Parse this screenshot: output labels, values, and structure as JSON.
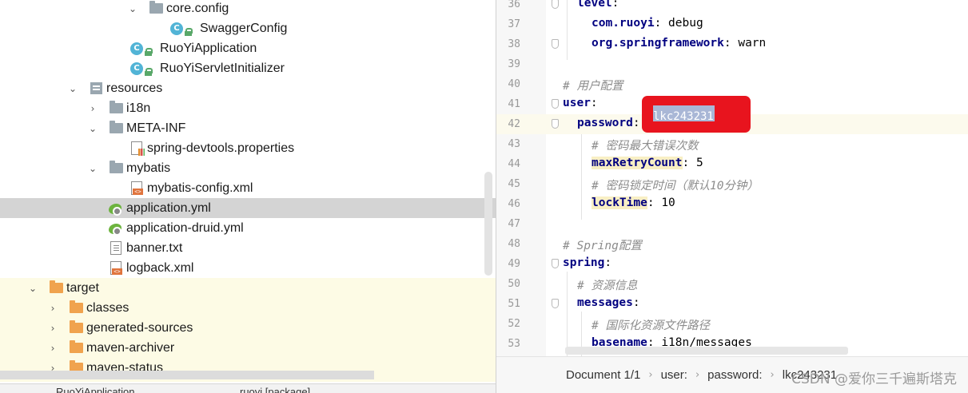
{
  "tree": {
    "items": [
      {
        "label": "core.config",
        "arrow": "⌄",
        "icon": "folder-gray"
      },
      {
        "label": "SwaggerConfig",
        "arrow": "",
        "icon": "class-c"
      },
      {
        "label": "RuoYiApplication",
        "arrow": "",
        "icon": "class-c"
      },
      {
        "label": "RuoYiServletInitializer",
        "arrow": "",
        "icon": "class-c"
      },
      {
        "label": "resources",
        "arrow": "⌄",
        "icon": "folder-res"
      },
      {
        "label": "i18n",
        "arrow": "›",
        "icon": "folder-gray"
      },
      {
        "label": "META-INF",
        "arrow": "⌄",
        "icon": "folder-gray"
      },
      {
        "label": "spring-devtools.properties",
        "arrow": "",
        "icon": "file-props"
      },
      {
        "label": "mybatis",
        "arrow": "⌄",
        "icon": "folder-gray"
      },
      {
        "label": "mybatis-config.xml",
        "arrow": "",
        "icon": "file-xml"
      },
      {
        "label": "application.yml",
        "arrow": "",
        "icon": "file-yml"
      },
      {
        "label": "application-druid.yml",
        "arrow": "",
        "icon": "file-yml"
      },
      {
        "label": "banner.txt",
        "arrow": "",
        "icon": "file-txt"
      },
      {
        "label": "logback.xml",
        "arrow": "",
        "icon": "file-xml"
      },
      {
        "label": "target",
        "arrow": "⌄",
        "icon": "folder-orange"
      },
      {
        "label": "classes",
        "arrow": "›",
        "icon": "folder-orange"
      },
      {
        "label": "generated-sources",
        "arrow": "›",
        "icon": "folder-orange"
      },
      {
        "label": "maven-archiver",
        "arrow": "›",
        "icon": "folder-orange"
      },
      {
        "label": "maven-status",
        "arrow": "›",
        "icon": "folder-orange"
      }
    ],
    "bottom_tabs": [
      "RuoYiApplication",
      "ruoyi [package]"
    ]
  },
  "editor": {
    "lines": [
      {
        "n": "36",
        "key": "level",
        "val": "",
        "comment": ""
      },
      {
        "n": "37",
        "key": "com.ruoyi",
        "val": "debug",
        "comment": ""
      },
      {
        "n": "38",
        "key": "org.springframework",
        "val": "warn",
        "comment": ""
      },
      {
        "n": "39",
        "key": "",
        "val": "",
        "comment": ""
      },
      {
        "n": "40",
        "key": "",
        "val": "",
        "comment": "# 用户配置"
      },
      {
        "n": "41",
        "key": "user",
        "val": "",
        "comment": ""
      },
      {
        "n": "42",
        "key": "password",
        "val": "lkc243231",
        "comment": ""
      },
      {
        "n": "43",
        "key": "",
        "val": "",
        "comment": "# 密码最大错误次数"
      },
      {
        "n": "44",
        "key": "maxRetryCount",
        "val": "5",
        "comment": ""
      },
      {
        "n": "45",
        "key": "",
        "val": "",
        "comment": "# 密码锁定时间（默认10分钟）"
      },
      {
        "n": "46",
        "key": "lockTime",
        "val": "10",
        "comment": ""
      },
      {
        "n": "47",
        "key": "",
        "val": "",
        "comment": ""
      },
      {
        "n": "48",
        "key": "",
        "val": "",
        "comment": "# Spring配置"
      },
      {
        "n": "49",
        "key": "spring",
        "val": "",
        "comment": ""
      },
      {
        "n": "50",
        "key": "",
        "val": "",
        "comment": "# 资源信息"
      },
      {
        "n": "51",
        "key": "messages",
        "val": "",
        "comment": ""
      },
      {
        "n": "52",
        "key": "",
        "val": "",
        "comment": "# 国际化资源文件路径"
      },
      {
        "n": "53",
        "key": "basename",
        "val": "i18n/messages",
        "comment": ""
      }
    ]
  },
  "breadcrumb": {
    "items": [
      "Document 1/1",
      "user:",
      "password:",
      "lkc243231"
    ]
  },
  "watermark": "CSDN @爱你三千遍斯塔克",
  "colors": {
    "key": "#000080",
    "comment": "#8c8c8c",
    "selection": "#214283",
    "redact": "#e8141e"
  }
}
